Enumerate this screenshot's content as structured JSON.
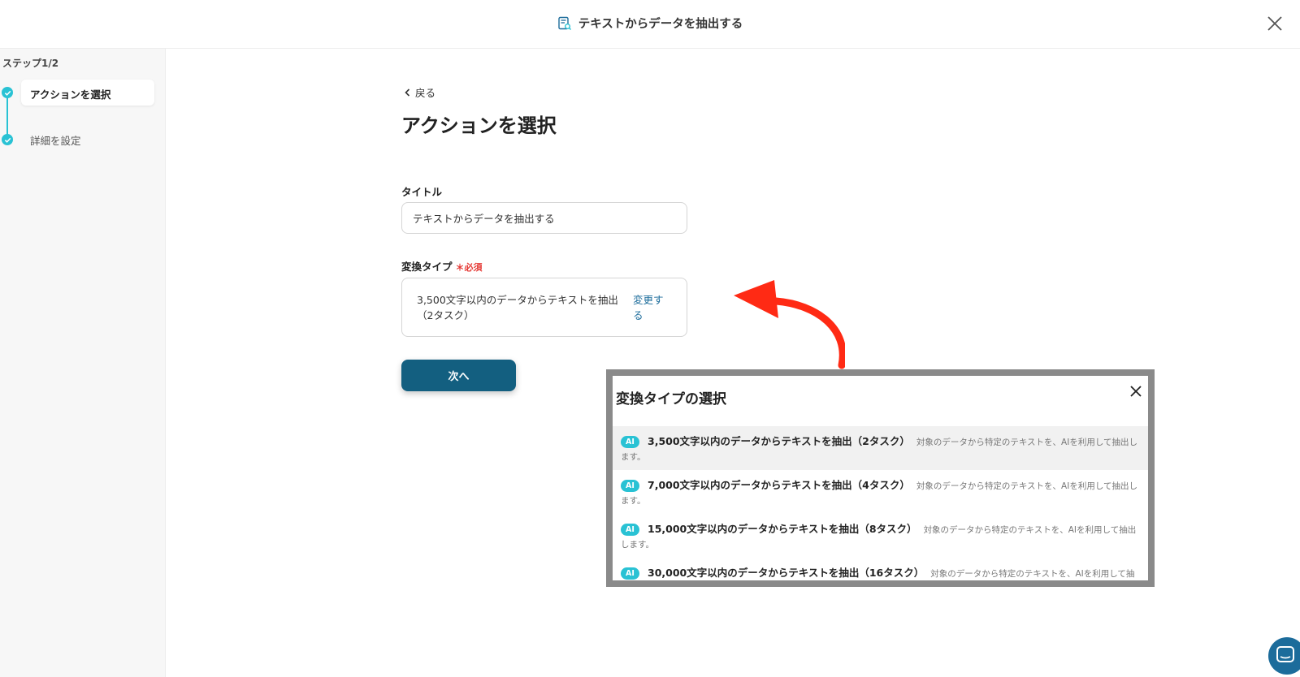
{
  "header": {
    "title": "テキストからデータを抽出する",
    "icon": "document-search-icon",
    "close_icon": "close-icon"
  },
  "sidebar": {
    "step_count": "ステップ1/2",
    "steps": [
      {
        "label": "アクションを選択",
        "state": "active"
      },
      {
        "label": "詳細を設定",
        "state": "inactive"
      }
    ],
    "accent_color": "#29c2d4"
  },
  "main": {
    "back_label": "戻る",
    "page_title": "アクションを選択",
    "title_field": {
      "label": "タイトル",
      "value": "テキストからデータを抽出する"
    },
    "type_field": {
      "label": "変換タイプ",
      "required_mark": "＊",
      "required_label": "必須",
      "value": "3,500文字以内のデータからテキストを抽出（2タスク）",
      "change_label": "変更する"
    },
    "next_label": "次へ",
    "primary_color": "#135f80"
  },
  "modal": {
    "title": "変換タイプの選択",
    "options": [
      {
        "badge": "AI",
        "name": "3,500文字以内のデータからテキストを抽出（2タスク）",
        "desc": "対象のデータから特定のテキストを、AIを利用して抽出します。",
        "selected": true
      },
      {
        "badge": "AI",
        "name": "7,000文字以内のデータからテキストを抽出（4タスク）",
        "desc": "対象のデータから特定のテキストを、AIを利用して抽出します。",
        "selected": false
      },
      {
        "badge": "AI",
        "name": "15,000文字以内のデータからテキストを抽出（8タスク）",
        "desc": "対象のデータから特定のテキストを、AIを利用して抽出します。",
        "selected": false
      },
      {
        "badge": "AI",
        "name": "30,000文字以内のデータからテキストを抽出（16タスク）",
        "desc": "対象のデータから特定のテキストを、AIを利用して抽出します。",
        "selected": false
      }
    ]
  },
  "annotation": {
    "arrow_color": "#ff2a14"
  },
  "chat_icon": "chat-bubble-icon"
}
